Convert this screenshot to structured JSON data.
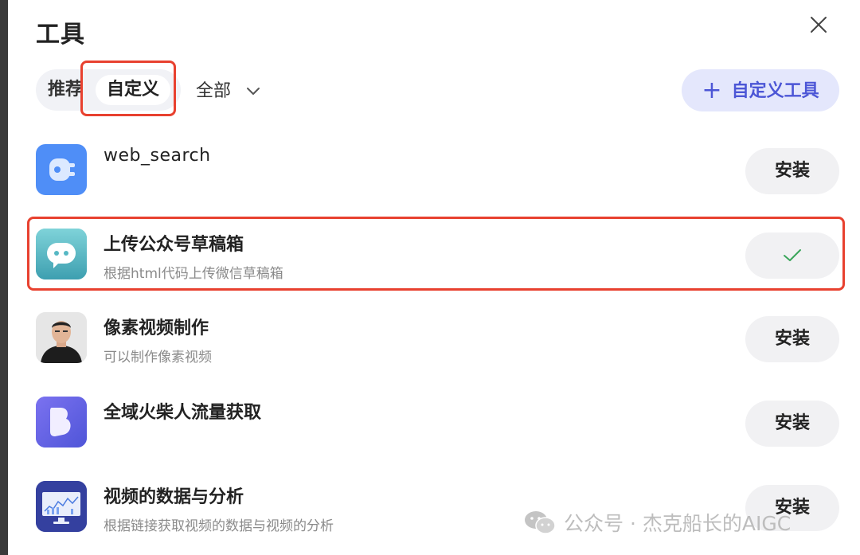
{
  "header": {
    "title": "工具",
    "close_icon": "close-icon"
  },
  "tabs": {
    "recommended_label": "推荐",
    "custom_label": "自定义",
    "active": "自定义",
    "filter_label": "全部"
  },
  "add_button": {
    "label": "自定义工具",
    "icon": "plus-icon"
  },
  "tools": [
    {
      "name": "web_search",
      "description": "",
      "status": "安装",
      "installed": false,
      "icon": "plug-icon",
      "icon_color": "#4f8ef7"
    },
    {
      "name": "上传公众号草稿箱",
      "description": "根据html代码上传微信草稿箱",
      "status": "",
      "installed": true,
      "icon": "chat-bubble-icon",
      "icon_color": "#56b8c4"
    },
    {
      "name": "像素视频制作",
      "description": "可以制作像素视频",
      "status": "安装",
      "installed": false,
      "icon": "avatar-photo",
      "icon_color": "#cfcfcf"
    },
    {
      "name": "全域火柴人流量获取",
      "description": "",
      "status": "安装",
      "installed": false,
      "icon": "b-logo-icon",
      "icon_color": "#6a6fe6"
    },
    {
      "name": "视频的数据与分析",
      "description": "根据链接获取视频的数据与视频的分析",
      "status": "安装",
      "installed": false,
      "icon": "monitor-chart-icon",
      "icon_color": "#3542a8"
    }
  ],
  "watermark": {
    "text": "公众号 · 杰克船长的AIGC",
    "icon": "wechat-icon"
  },
  "colors": {
    "accent": "#4c56d6",
    "accent_bg": "#e4e7fc",
    "highlight": "#e8412f",
    "check": "#3aa55a"
  }
}
